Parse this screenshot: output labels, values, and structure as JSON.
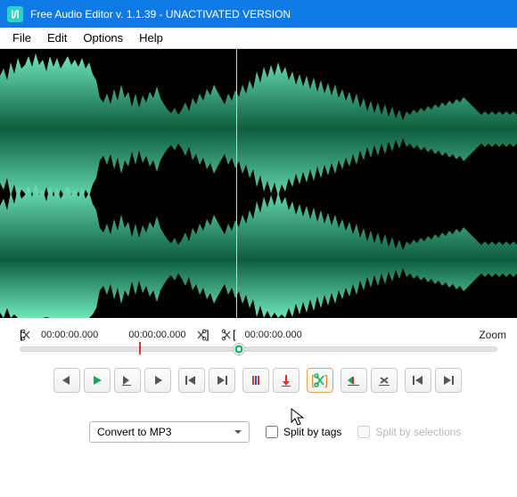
{
  "window": {
    "title": "Free Audio Editor v. 1.1.39 - UNACTIVATED VERSION"
  },
  "menu": {
    "file": "File",
    "edit": "Edit",
    "options": "Options",
    "help": "Help"
  },
  "timebar": {
    "sel_start": "00:00:00.000",
    "sel_end": "00:00:00.000",
    "cursor_pos": "00:00:00.000",
    "zoom_label": "Zoom"
  },
  "convert": {
    "select_value": "Convert to MP3",
    "split_tags": "Split by tags",
    "split_selections": "Split by selections"
  },
  "icons": {
    "scissor_open": "[✂",
    "scissor_close": "✂]",
    "scissor_green": "[✂]"
  }
}
